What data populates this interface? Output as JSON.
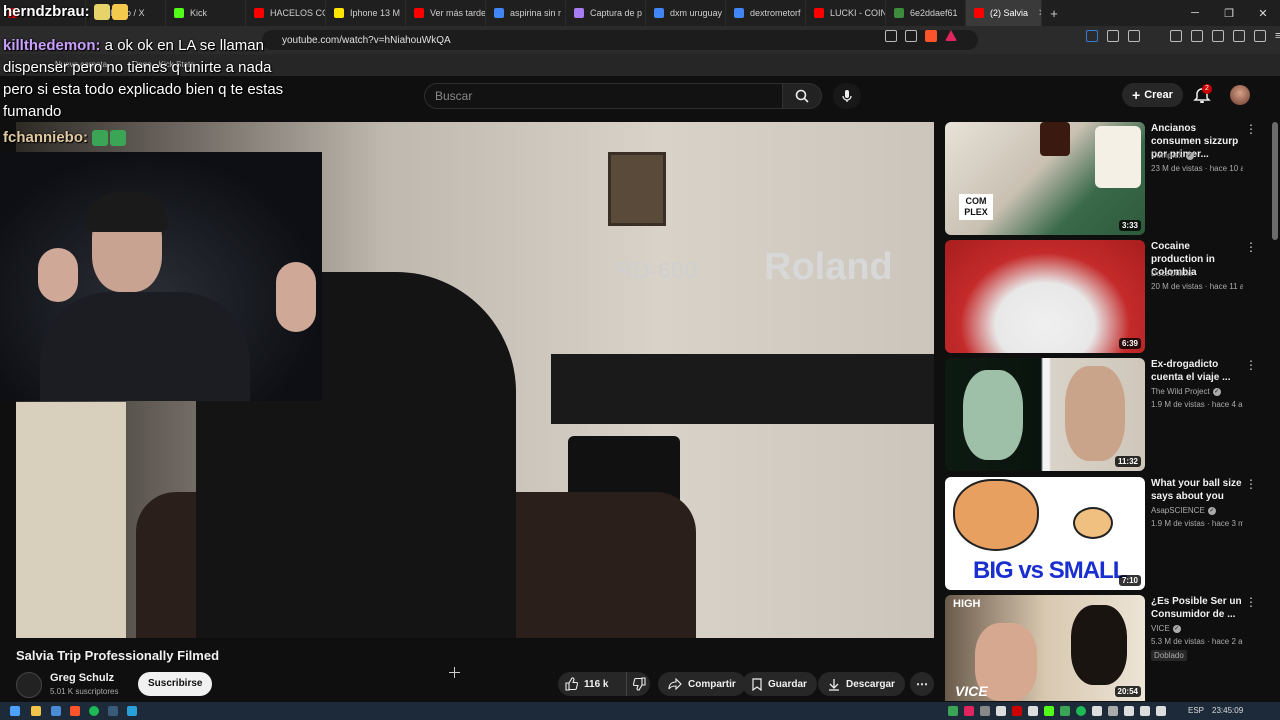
{
  "browser": {
    "tabs": [
      {
        "label": "",
        "color": "#cc0000"
      },
      {
        "label": "Inicio / X",
        "color": "#ffffff"
      },
      {
        "label": "Kick",
        "color": "#53fc18"
      },
      {
        "label": "HACELOS CO",
        "color": "#ff0000"
      },
      {
        "label": "Iphone 13 M",
        "color": "#ffe600"
      },
      {
        "label": "Ver más tarde",
        "color": "#ff0000"
      },
      {
        "label": "aspirina sin r",
        "color": "#4285f4"
      },
      {
        "label": "Captura de p",
        "color": "#a67cf0"
      },
      {
        "label": "dxm uruguay",
        "color": "#4285f4"
      },
      {
        "label": "dextrometorf",
        "color": "#4285f4"
      },
      {
        "label": "LUCKI - COIN",
        "color": "#ff0000"
      },
      {
        "label": "6e2ddaef61",
        "color": "#3c8c3c"
      },
      {
        "label": "(2) Salvia",
        "color": "#ff0000"
      }
    ],
    "url": "youtube.com/watch?v=hNiahouWkQA",
    "bookmarks": [
      "Nueva carpeta",
      "Ongo - Kick Stats"
    ]
  },
  "youtube": {
    "search_placeholder": "Buscar",
    "create_label": "Crear",
    "notifications_count": "2"
  },
  "chat": [
    {
      "user": "herndzbrau:",
      "text": ""
    },
    {
      "user": "killthedemon:",
      "text": " a ok ok en LA se llaman"
    },
    {
      "user": "",
      "text": "dispenser pero no tienes q unirte a nada"
    },
    {
      "user": "",
      "text": "pero si esta todo explicado bien q te estas"
    },
    {
      "user": "",
      "text": "fumando"
    },
    {
      "user": "fchanniebo:",
      "text": ""
    }
  ],
  "video": {
    "keyboard_brand": "Roland",
    "keyboard_model": "RD-600",
    "title": "Salvia Trip Professionally Filmed",
    "channel": "Greg Schulz",
    "subscribers": "5.01 K suscriptores",
    "subscribe_label": "Suscribirse",
    "likes": "116 k",
    "share_label": "Compartir",
    "save_label": "Guardar",
    "download_label": "Descargar"
  },
  "recommendations": [
    {
      "title": "Ancianos consumen sizzurp por primer...",
      "channel": "Complex",
      "meta": "23 M de vistas · hace 10 a...",
      "duration": "3:33",
      "badge": "",
      "thumb_text": "COM PLEX"
    },
    {
      "title": "Cocaine production in Colombia",
      "channel": "DocsOnline",
      "meta": "20 M de vistas · hace 11 a...",
      "duration": "6:39",
      "badge": "",
      "thumb_text": ""
    },
    {
      "title": "Ex-drogadicto cuenta el viaje ...",
      "channel": "The Wild Project",
      "meta": "1.9 M de vistas · hace 4 añ...",
      "duration": "11:32",
      "badge": "",
      "thumb_text": ""
    },
    {
      "title": "What your ball size says about you",
      "channel": "AsapSCIENCE",
      "meta": "1.9 M de vistas · hace 3 m...",
      "duration": "7:10",
      "badge": "",
      "thumb_text": "BIG vs SMALL"
    },
    {
      "title": "¿Es Posible Ser un Consumidor de ...",
      "channel": "VICE",
      "meta": "5.3 M de vistas · hace 2 añ...",
      "duration": "20:54",
      "badge": "Doblado",
      "thumb_text": "VICE"
    }
  ],
  "taskbar": {
    "lang": "ESP",
    "time": "23:45:09"
  }
}
